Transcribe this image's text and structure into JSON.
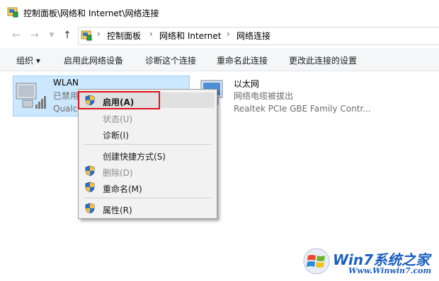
{
  "window": {
    "title": "控制面板\\网络和 Internet\\网络连接"
  },
  "nav": {
    "back_icon": "back-arrow-icon",
    "forward_icon": "forward-arrow-icon",
    "recent_icon": "chevron-down-icon",
    "up_icon": "up-arrow-icon",
    "breadcrumb": [
      "控制面板",
      "网络和 Internet",
      "网络连接"
    ],
    "separator": "›"
  },
  "commands": {
    "organize": "组织 ▾",
    "enable_device": "启用此网络设备",
    "diagnose": "诊断这个连接",
    "rename": "重命名此连接",
    "change_settings": "更改此连接的设置"
  },
  "connections": [
    {
      "name": "WLAN",
      "status": "已禁用",
      "device": "Qualc",
      "icon": "wireless-network-icon"
    },
    {
      "name": "以太网",
      "status": "网络电缆被拔出",
      "device": "Realtek PCIe GBE Family Contr...",
      "icon": "ethernet-network-icon"
    }
  ],
  "context_menu": {
    "items": [
      {
        "label": "启用(A)",
        "enabled": true,
        "shield": true
      },
      {
        "label": "状态(U)",
        "enabled": false,
        "shield": false
      },
      {
        "label": "诊断(I)",
        "enabled": true,
        "shield": false
      },
      {
        "label": "创建快捷方式(S)",
        "enabled": true,
        "shield": false
      },
      {
        "label": "删除(D)",
        "enabled": false,
        "shield": true
      },
      {
        "label": "重命名(M)",
        "enabled": true,
        "shield": true
      },
      {
        "label": "属性(R)",
        "enabled": true,
        "shield": true
      }
    ]
  },
  "watermark": {
    "brand": "Win7系统之家",
    "url": "Www.Winwin7.com"
  },
  "colors": {
    "selection": "#cce8ff",
    "highlight_box": "#e01020",
    "watermark": "#1d5fbf"
  }
}
